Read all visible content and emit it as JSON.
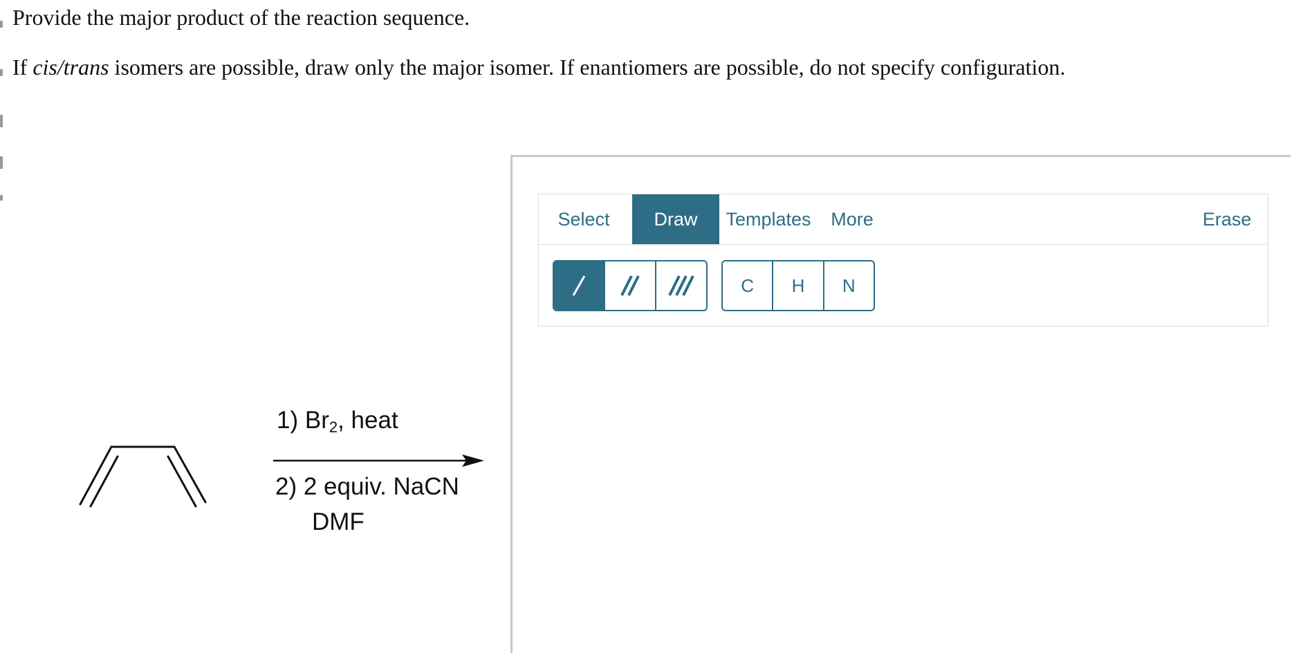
{
  "question": {
    "line1": "Provide the major product of the reaction sequence.",
    "line2_prefix": "If ",
    "line2_italic1": "cis",
    "line2_slash": "/",
    "line2_italic2": "trans",
    "line2_rest": " isomers are possible, draw only the major isomer. If enantiomers are possible, do not specify configuration."
  },
  "reaction": {
    "step1_prefix": "1) Br",
    "step1_sub": "2",
    "step1_suffix": ", heat",
    "step2": "2) 2 equiv. NaCN",
    "solvent": "DMF"
  },
  "editor": {
    "tabs": {
      "select": "Select",
      "draw": "Draw",
      "templates": "Templates",
      "more": "More",
      "erase": "Erase"
    },
    "active_tab": "Draw",
    "bond_tools": [
      "single-bond-icon",
      "double-bond-icon",
      "triple-bond-icon"
    ],
    "active_bond_tool": "single-bond-icon",
    "atoms": [
      "C",
      "H",
      "N"
    ],
    "accent_color": "#2e6d86"
  }
}
